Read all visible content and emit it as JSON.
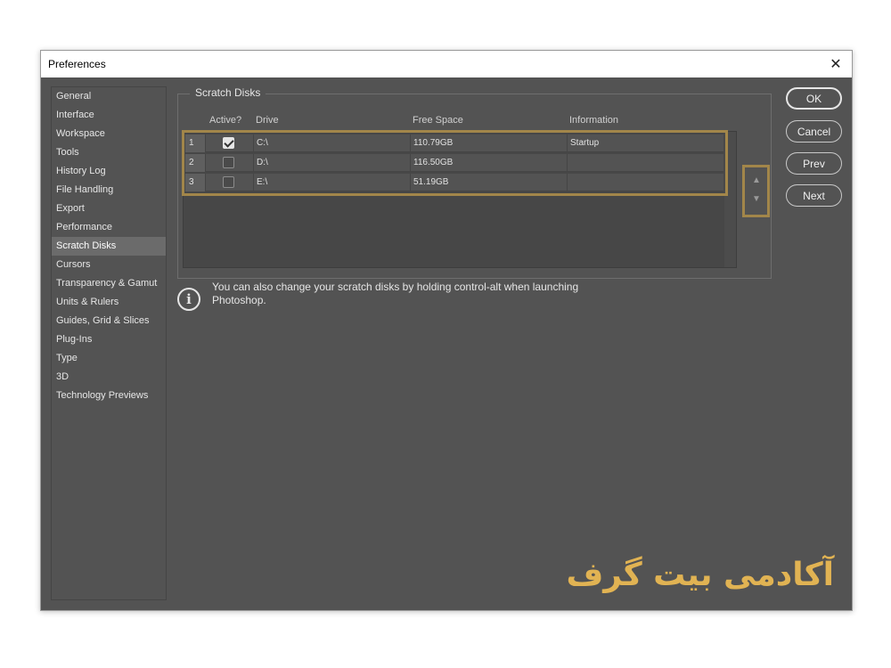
{
  "window": {
    "title": "Preferences"
  },
  "sidebar": {
    "items": [
      {
        "label": "General"
      },
      {
        "label": "Interface"
      },
      {
        "label": "Workspace"
      },
      {
        "label": "Tools"
      },
      {
        "label": "History Log"
      },
      {
        "label": "File Handling"
      },
      {
        "label": "Export"
      },
      {
        "label": "Performance"
      },
      {
        "label": "Scratch Disks",
        "selected": true
      },
      {
        "label": "Cursors"
      },
      {
        "label": "Transparency & Gamut"
      },
      {
        "label": "Units & Rulers"
      },
      {
        "label": "Guides, Grid & Slices"
      },
      {
        "label": "Plug-Ins"
      },
      {
        "label": "Type"
      },
      {
        "label": "3D"
      },
      {
        "label": "Technology Previews"
      }
    ]
  },
  "scratch": {
    "title": "Scratch Disks",
    "columns": {
      "active": "Active?",
      "drive": "Drive",
      "free_space": "Free Space",
      "information": "Information"
    },
    "rows": [
      {
        "num": "1",
        "active": true,
        "drive": "C:\\",
        "free_space": "110.79GB",
        "information": "Startup"
      },
      {
        "num": "2",
        "active": false,
        "drive": "D:\\",
        "free_space": "116.50GB",
        "information": ""
      },
      {
        "num": "3",
        "active": false,
        "drive": "E:\\",
        "free_space": "51.19GB",
        "information": ""
      }
    ],
    "info_message": "You can also change your scratch disks by holding control-alt when launching Photoshop."
  },
  "buttons": {
    "ok": "OK",
    "cancel": "Cancel",
    "prev": "Prev",
    "next": "Next"
  },
  "watermark": "آکادمی بیت گرف",
  "colors": {
    "highlight": "#a2864a",
    "watermark": "#e1b353",
    "panel": "#535353"
  }
}
